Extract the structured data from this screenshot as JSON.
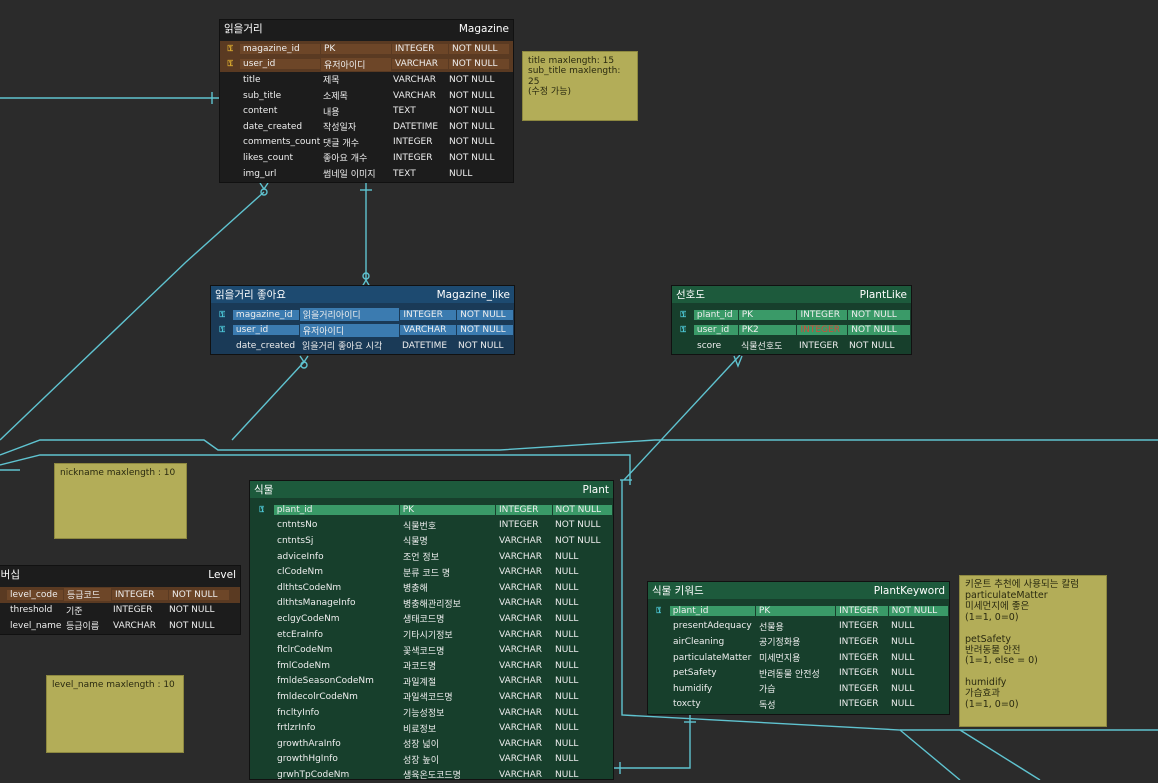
{
  "colors": {
    "line": "#5fc3d0",
    "background": "#2b2b2b",
    "note": "#b3ad58"
  },
  "magazine": {
    "title": "읽을거리",
    "entity": "Magazine",
    "rows": [
      {
        "pk": true,
        "cells": [
          "magazine_id",
          "PK",
          "INTEGER",
          "NOT NULL"
        ]
      },
      {
        "pk": true,
        "cells": [
          "user_id",
          "유저아이디",
          "VARCHAR",
          "NOT NULL"
        ]
      },
      {
        "pk": false,
        "cells": [
          "title",
          "제목",
          "VARCHAR",
          "NOT NULL"
        ]
      },
      {
        "pk": false,
        "cells": [
          "sub_title",
          "소제목",
          "VARCHAR",
          "NOT NULL"
        ]
      },
      {
        "pk": false,
        "cells": [
          "content",
          "내용",
          "TEXT",
          "NOT NULL"
        ]
      },
      {
        "pk": false,
        "cells": [
          "date_created",
          "작성일자",
          "DATETIME",
          "NOT NULL"
        ]
      },
      {
        "pk": false,
        "cells": [
          "comments_count",
          "댓글 개수",
          "INTEGER",
          "NOT NULL"
        ]
      },
      {
        "pk": false,
        "cells": [
          "likes_count",
          "좋아요 개수",
          "INTEGER",
          "NOT NULL"
        ]
      },
      {
        "pk": false,
        "cells": [
          "img_url",
          "썸네일 이미지",
          "TEXT",
          "NULL"
        ]
      }
    ]
  },
  "magazine_like": {
    "title": "읽을거리 좋아요",
    "entity": "Magazine_like",
    "rows": [
      {
        "pk": true,
        "cells": [
          "magazine_id",
          "읽을거리아이디",
          "INTEGER",
          "NOT NULL"
        ]
      },
      {
        "pk": true,
        "cells": [
          "user_id",
          "유저아이디",
          "VARCHAR",
          "NOT NULL"
        ]
      },
      {
        "pk": false,
        "cells": [
          "date_created",
          "읽을거리 좋아요 시각",
          "DATETIME",
          "NOT NULL"
        ]
      }
    ]
  },
  "plantlike": {
    "title": "선호도",
    "entity": "PlantLike",
    "rows": [
      {
        "pk": true,
        "cells": [
          "plant_id",
          "PK",
          "INTEGER",
          "NOT NULL"
        ]
      },
      {
        "pk": true,
        "cells": [
          "user_id",
          "PK2",
          "INTEGER",
          "NOT NULL"
        ]
      },
      {
        "pk": false,
        "cells": [
          "score",
          "식물선호도",
          "INTEGER",
          "NOT NULL"
        ]
      }
    ]
  },
  "level": {
    "title": "멤버십",
    "entity": "Level",
    "rows": [
      {
        "pk": true,
        "cells": [
          "level_code",
          "등급코드",
          "INTEGER",
          "NOT NULL"
        ]
      },
      {
        "pk": false,
        "cells": [
          "threshold",
          "기준",
          "INTEGER",
          "NOT NULL"
        ]
      },
      {
        "pk": false,
        "cells": [
          "level_name",
          "등급이름",
          "VARCHAR",
          "NOT NULL"
        ]
      }
    ]
  },
  "plant": {
    "title": "식물",
    "entity": "Plant",
    "rows": [
      {
        "pk": true,
        "cells": [
          "plant_id",
          "PK",
          "INTEGER",
          "NOT NULL"
        ]
      },
      {
        "pk": false,
        "cells": [
          "cntntsNo",
          "식물번호",
          "INTEGER",
          "NOT NULL"
        ]
      },
      {
        "pk": false,
        "cells": [
          "cntntsSj",
          "식물명",
          "VARCHAR",
          "NOT NULL"
        ]
      },
      {
        "pk": false,
        "cells": [
          "adviceInfo",
          "조언 정보",
          "VARCHAR",
          "NULL"
        ]
      },
      {
        "pk": false,
        "cells": [
          "clCodeNm",
          "분류 코드 명",
          "VARCHAR",
          "NULL"
        ]
      },
      {
        "pk": false,
        "cells": [
          "dlthtsCodeNm",
          "병충해",
          "VARCHAR",
          "NULL"
        ]
      },
      {
        "pk": false,
        "cells": [
          "dlthtsManageInfo",
          "병충해관리정보",
          "VARCHAR",
          "NULL"
        ]
      },
      {
        "pk": false,
        "cells": [
          "eclgyCodeNm",
          "생태코드명",
          "VARCHAR",
          "NULL"
        ]
      },
      {
        "pk": false,
        "cells": [
          "etcEraInfo",
          "기타시기정보",
          "VARCHAR",
          "NULL"
        ]
      },
      {
        "pk": false,
        "cells": [
          "flclrCodeNm",
          "꽃색코드명",
          "VARCHAR",
          "NULL"
        ]
      },
      {
        "pk": false,
        "cells": [
          "fmlCodeNm",
          "과코드명",
          "VARCHAR",
          "NULL"
        ]
      },
      {
        "pk": false,
        "cells": [
          "fmldeSeasonCodeNm",
          "과일계절",
          "VARCHAR",
          "NULL"
        ]
      },
      {
        "pk": false,
        "cells": [
          "fmldecolrCodeNm",
          "과일색코드명",
          "VARCHAR",
          "NULL"
        ]
      },
      {
        "pk": false,
        "cells": [
          "fncltyInfo",
          "기능성정보",
          "VARCHAR",
          "NULL"
        ]
      },
      {
        "pk": false,
        "cells": [
          "frtlzrInfo",
          "비료정보",
          "VARCHAR",
          "NULL"
        ]
      },
      {
        "pk": false,
        "cells": [
          "growthAraInfo",
          "성장 넓이",
          "VARCHAR",
          "NULL"
        ]
      },
      {
        "pk": false,
        "cells": [
          "growthHgInfo",
          "성장 높이",
          "VARCHAR",
          "NULL"
        ]
      },
      {
        "pk": false,
        "cells": [
          "grwhTpCodeNm",
          "생육온도코드명",
          "VARCHAR",
          "NULL"
        ]
      }
    ]
  },
  "plantkeyword": {
    "title": "식물 키워드",
    "entity": "PlantKeyword",
    "rows": [
      {
        "pk": true,
        "cells": [
          "plant_id",
          "PK",
          "INTEGER",
          "NOT NULL"
        ]
      },
      {
        "pk": false,
        "cells": [
          "presentAdequacy",
          "선물용",
          "INTEGER",
          "NULL"
        ]
      },
      {
        "pk": false,
        "cells": [
          "airCleaning",
          "공기정화용",
          "INTEGER",
          "NULL"
        ]
      },
      {
        "pk": false,
        "cells": [
          "particulateMatter",
          "미세먼지용",
          "INTEGER",
          "NULL"
        ]
      },
      {
        "pk": false,
        "cells": [
          "petSafety",
          "반려동물 안전성",
          "INTEGER",
          "NULL"
        ]
      },
      {
        "pk": false,
        "cells": [
          "humidify",
          "가습",
          "INTEGER",
          "NULL"
        ]
      },
      {
        "pk": false,
        "cells": [
          "toxcty",
          "독성",
          "INTEGER",
          "NULL"
        ]
      }
    ]
  },
  "notes": {
    "magazine": [
      "title maxlength: 15",
      "sub_title maxlength:",
      "25",
      "(수정 가능)"
    ],
    "nickname": [
      "nickname maxlength : 10"
    ],
    "level_name": [
      "level_name maxlength : 10"
    ],
    "keyword": [
      "키운트 추천에 사용되는 칼럼",
      "particulateMatter",
      "미세먼지에 좋은",
      "(1=1, 0=0)",
      "",
      "petSafety",
      "반려동물 안전",
      "(1=1, else = 0)",
      "",
      "humidify",
      "가습효과",
      "(1=1, 0=0)"
    ]
  }
}
